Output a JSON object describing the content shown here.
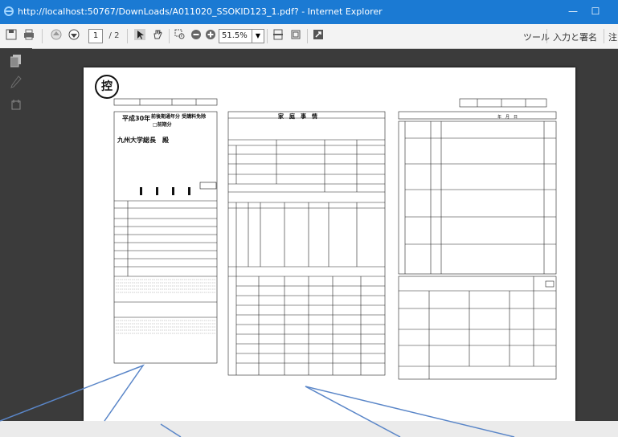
{
  "window": {
    "title": "http://localhost:50767/DownLoads/A011020_SSOKID123_1.pdf? - Internet Explorer",
    "minimize": "—",
    "maximize": "☐"
  },
  "toolbar": {
    "page_current": "1",
    "page_total": "/ 2",
    "zoom": "51.5%",
    "tools_label": "ツール",
    "fill_sign_label": "入力と署名",
    "comment_label": "注"
  },
  "document": {
    "stamp": "控",
    "form_title_year": "平成30年",
    "form_title_main": "前後期通年分 受講料免除",
    "form_title_sub": "□前期分",
    "recipient": "九州大学総長　殿",
    "center_heading": "家　庭　事　情",
    "col_date": "年　月　日"
  }
}
